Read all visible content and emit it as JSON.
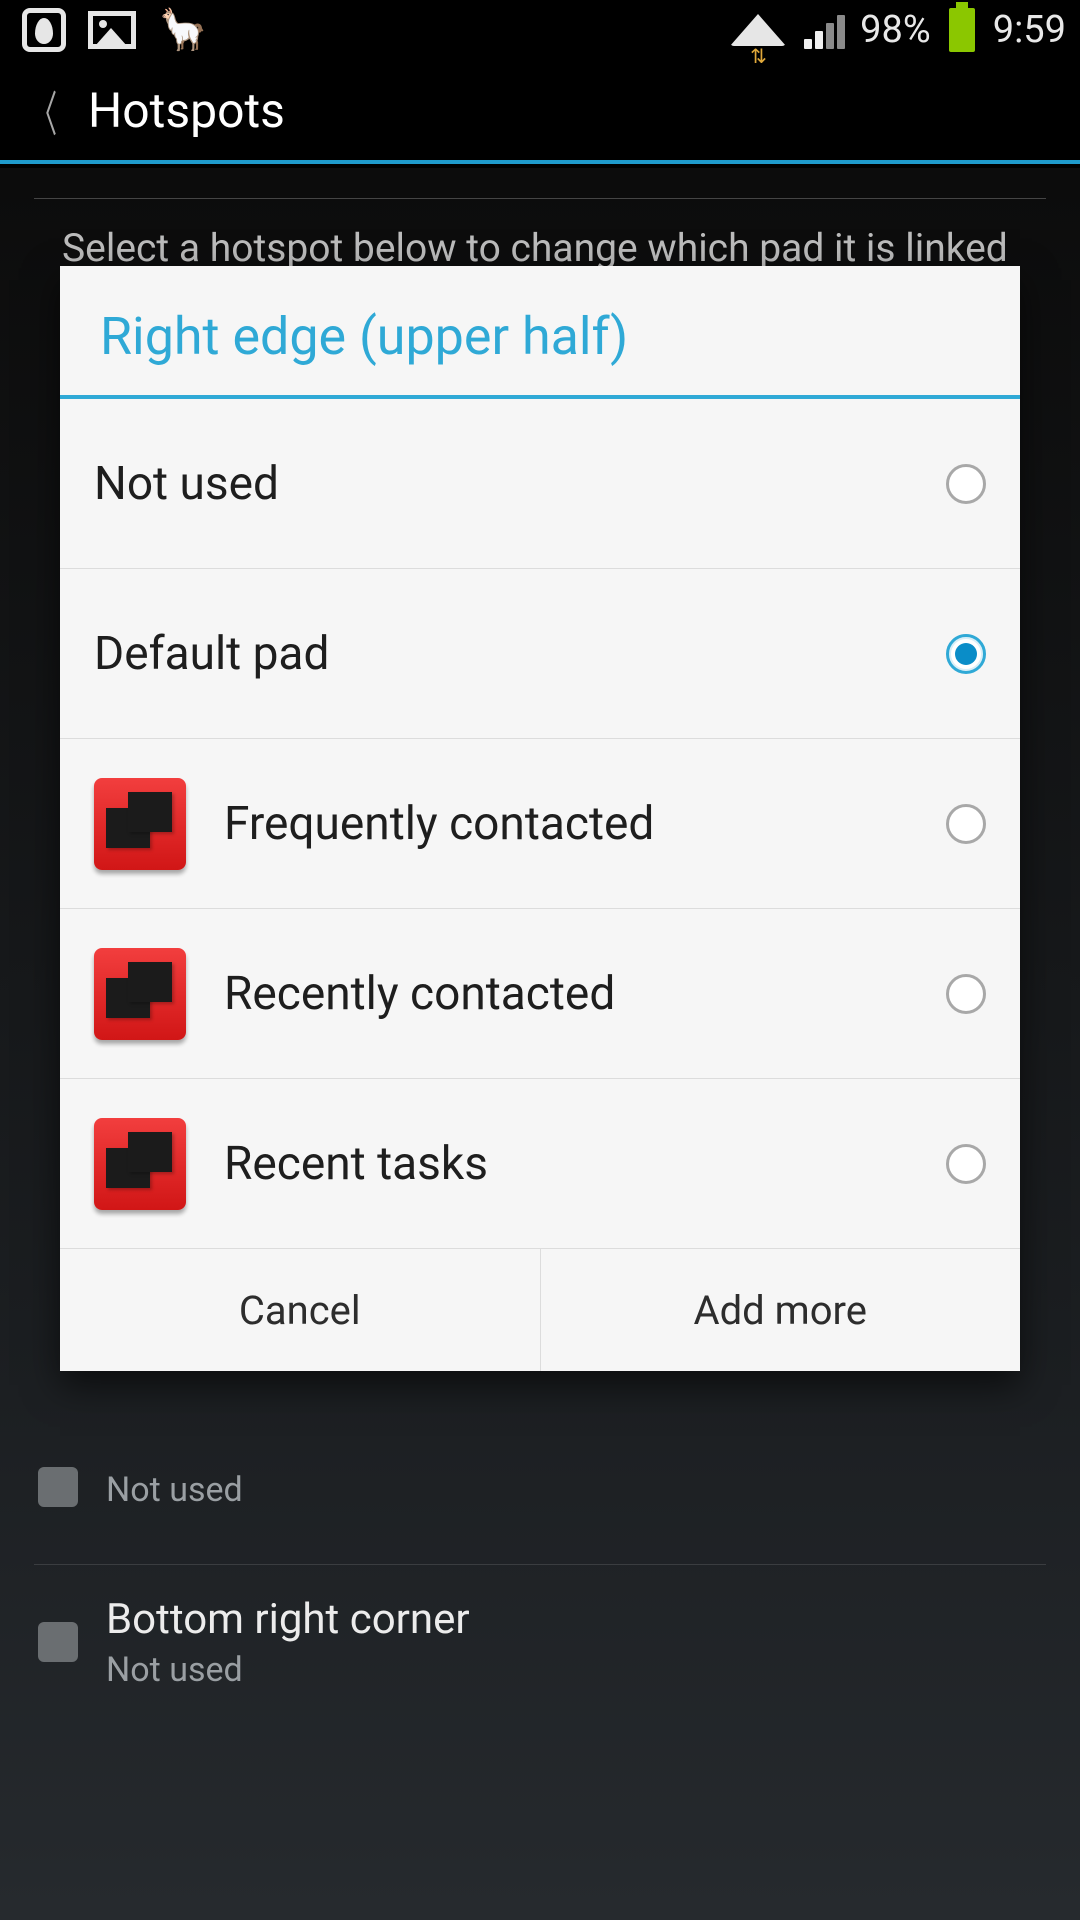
{
  "status_bar": {
    "battery_text": "98%",
    "clock": "9:59"
  },
  "header": {
    "title": "Hotspots"
  },
  "page": {
    "hint": "Select a hotspot below to change which pad it is linked to",
    "bg_items": [
      {
        "title": "",
        "subtitle": "Not used"
      },
      {
        "title": "Bottom right corner",
        "subtitle": "Not used"
      }
    ]
  },
  "dialog": {
    "title": "Right edge (upper half)",
    "options": [
      {
        "label": "Not used",
        "has_icon": false,
        "selected": false
      },
      {
        "label": "Default pad",
        "has_icon": false,
        "selected": true
      },
      {
        "label": "Frequently contacted",
        "has_icon": true,
        "selected": false
      },
      {
        "label": "Recently contacted",
        "has_icon": true,
        "selected": false
      },
      {
        "label": "Recent tasks",
        "has_icon": true,
        "selected": false
      }
    ],
    "buttons": {
      "cancel": "Cancel",
      "add_more": "Add more"
    }
  }
}
